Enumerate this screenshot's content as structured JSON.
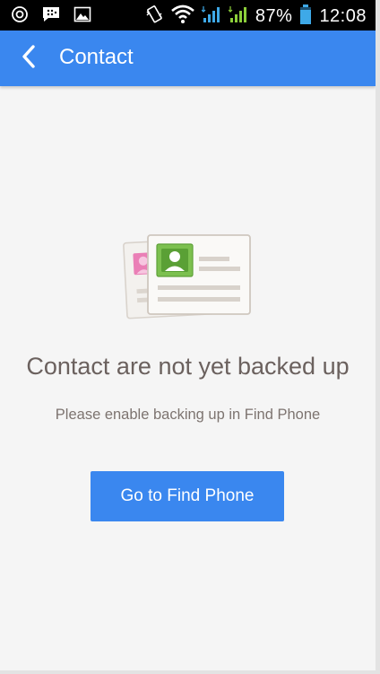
{
  "status_bar": {
    "battery": "87%",
    "time": "12:08",
    "icons": [
      "target-icon",
      "messenger-icon",
      "image-icon",
      "vibrate-icon",
      "wifi-icon",
      "signal-icon",
      "signal-icon",
      "battery-icon"
    ]
  },
  "app_bar": {
    "title": "Contact",
    "back_icon": "chevron-left-icon",
    "color": "#3a87ef"
  },
  "empty_state": {
    "illustration": "contact-cards-icon",
    "title": "Contact are not yet backed up",
    "subtitle": "Please enable backing up in Find Phone",
    "button_label": "Go to Find Phone"
  }
}
